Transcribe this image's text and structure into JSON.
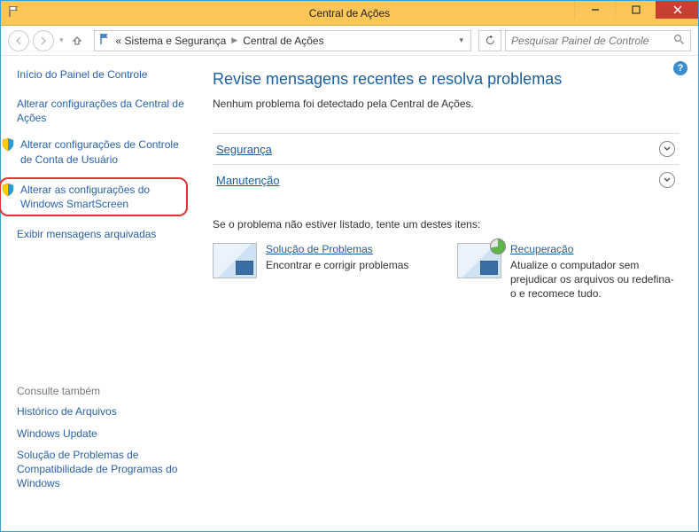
{
  "window": {
    "title": "Central de Ações"
  },
  "breadcrumb": {
    "seg1": "« Sistema e Segurança",
    "seg2": "Central de Ações"
  },
  "search": {
    "placeholder": "Pesquisar Painel de Controle"
  },
  "sidebar": {
    "home": "Início do Painel de Controle",
    "items": [
      {
        "label": "Alterar configurações da Central de Ações",
        "shield": false
      },
      {
        "label": "Alterar configurações de Controle de Conta de Usuário",
        "shield": true
      },
      {
        "label": "Alterar as configurações do Windows SmartScreen",
        "shield": true,
        "highlight": true
      },
      {
        "label": "Exibir mensagens arquivadas",
        "shield": false
      }
    ],
    "seealso_head": "Consulte também",
    "seealso": [
      "Histórico de Arquivos",
      "Windows Update",
      "Solução de Problemas de Compatibilidade de Programas do Windows"
    ]
  },
  "main": {
    "heading": "Revise mensagens recentes e resolva problemas",
    "subtext": "Nenhum problema foi detectado pela Central de Ações.",
    "sections": [
      {
        "label": "Segurança"
      },
      {
        "label": "Manutenção"
      }
    ],
    "try_head": "Se o problema não estiver listado, tente um destes itens:",
    "cards": [
      {
        "title": "Solução de Problemas",
        "desc": "Encontrar e corrigir problemas"
      },
      {
        "title": "Recuperação",
        "desc": "Atualize o computador sem prejudicar os arquivos ou redefina-o e recomece tudo."
      }
    ]
  }
}
